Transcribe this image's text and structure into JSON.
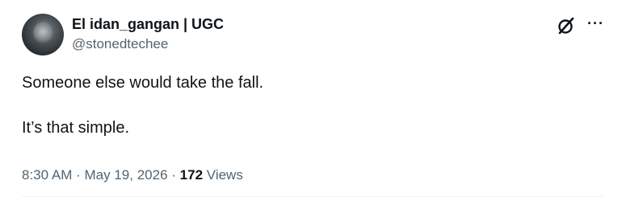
{
  "author": {
    "display_name": "El idan_gangan | UGC",
    "handle": "@stonedtechee"
  },
  "actions": {
    "grok_icon": "grok-icon",
    "more_icon": "more-icon",
    "more_glyph": "···"
  },
  "post": {
    "lines": [
      "Someone else would take the fall.",
      "It’s that simple."
    ]
  },
  "meta": {
    "time": "8:30 AM",
    "separator": "·",
    "date": "May 19, 2026",
    "views_count": "172",
    "views_label": "Views"
  },
  "colors": {
    "text_primary": "#0f1419",
    "text_secondary": "#536471",
    "divider": "#eff3f4"
  }
}
